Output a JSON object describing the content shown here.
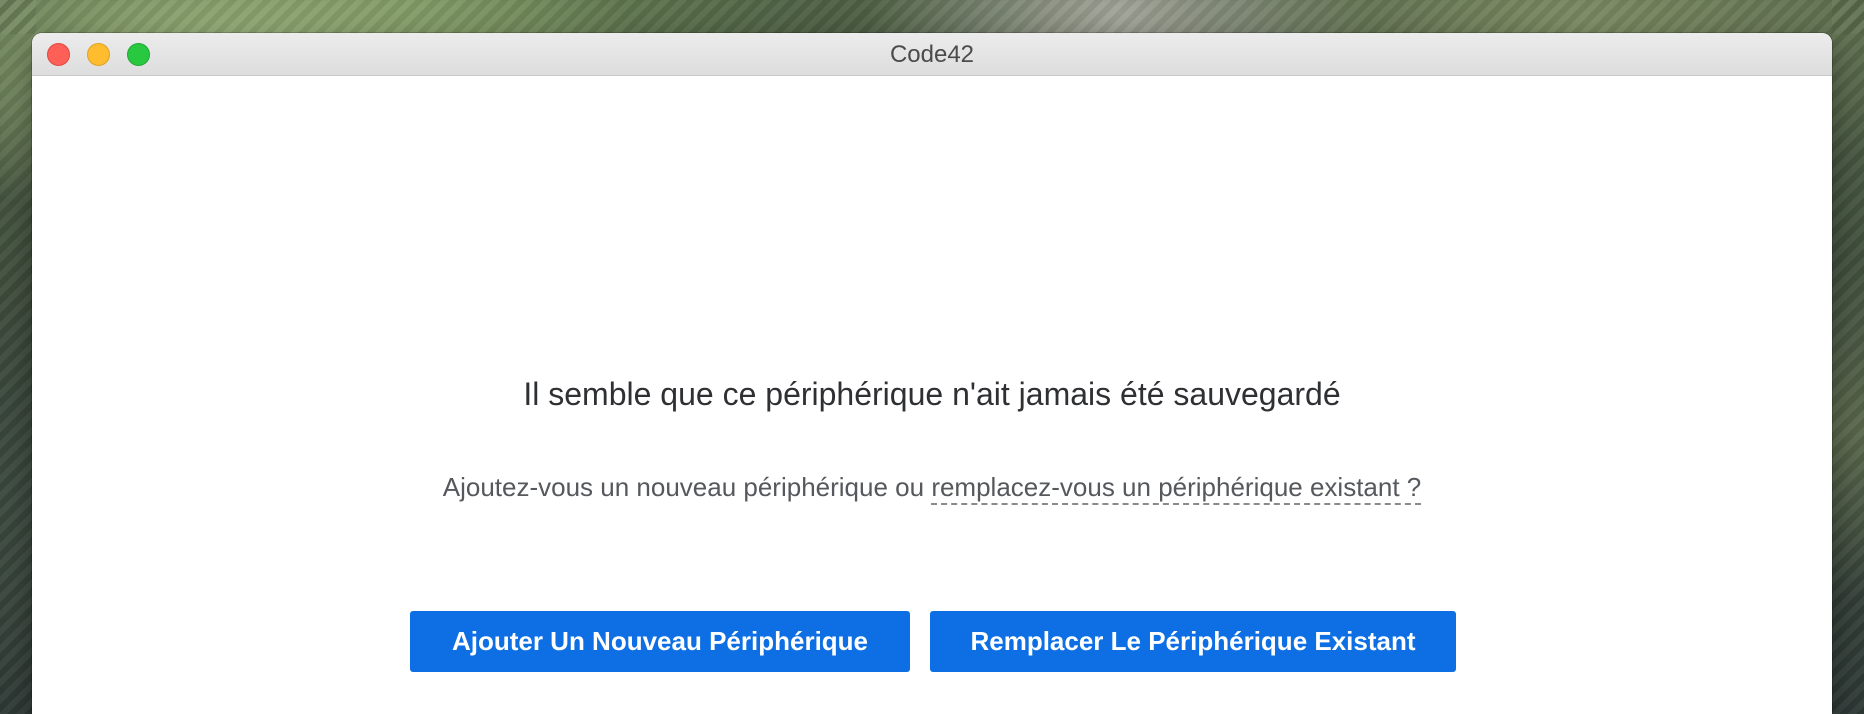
{
  "window": {
    "title": "Code42"
  },
  "main": {
    "heading": "Il semble que ce périphérique n'ait jamais été sauvegardé",
    "question_prefix": "Ajoutez-vous un nouveau périphérique ou ",
    "question_link": "remplacez-vous un périphérique existant ?"
  },
  "buttons": {
    "add_label": "Ajouter Un Nouveau Périphérique",
    "replace_label": "Remplacer Le Périphérique Existant"
  },
  "colors": {
    "primary_button": "#0d6fe3",
    "window_background": "#ffffff",
    "close_button": "#fe5f57",
    "minimize_button": "#febc2e",
    "maximize_button": "#28c840"
  }
}
